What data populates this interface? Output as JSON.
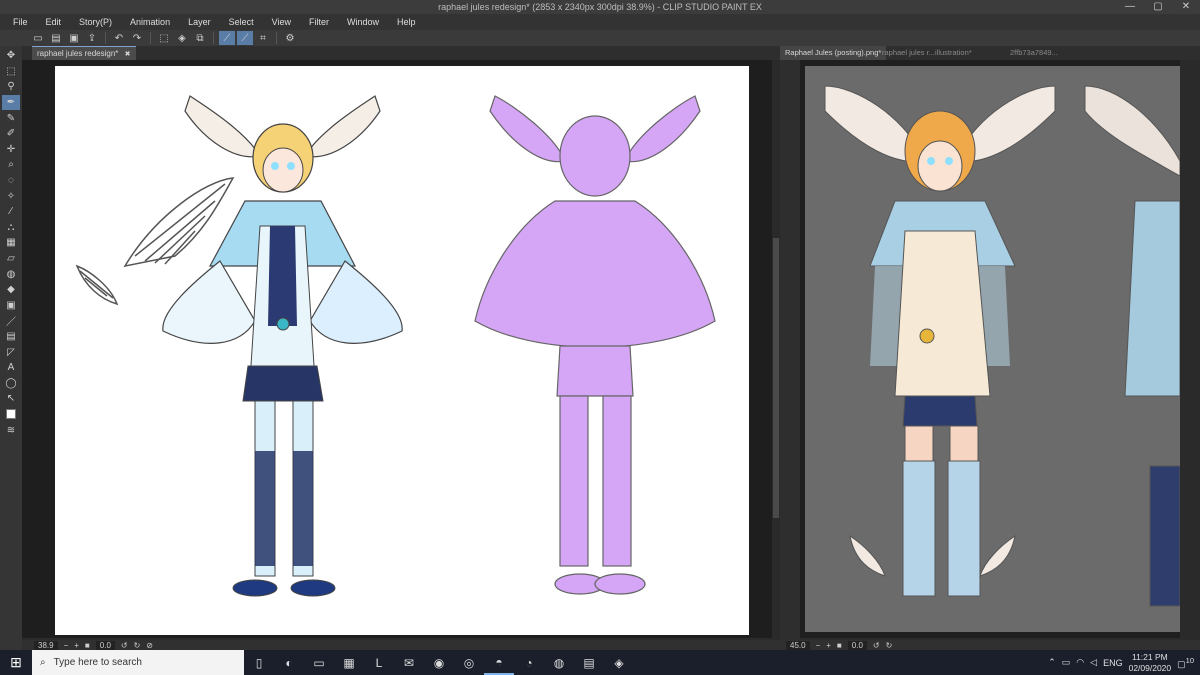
{
  "window": {
    "title": "raphael jules redesign* (2853 x 2340px 300dpi 38.9%)  - CLIP STUDIO PAINT EX",
    "minimize": "—",
    "maximize": "▢",
    "close": "✕"
  },
  "menu": [
    "File",
    "Edit",
    "Story(P)",
    "Animation",
    "Layer",
    "Select",
    "View",
    "Filter",
    "Window",
    "Help"
  ],
  "left_canvas": {
    "tab_label": "raphael jules redesign*",
    "tab_close": "✖",
    "zoom": "38.9",
    "rotation": "0.0"
  },
  "right_canvas": {
    "tabs": [
      "Raphael Jules (posting).png*",
      "raphael jules r...",
      "illustration*",
      "2ffb73a7849..."
    ],
    "zoom": "45.0",
    "rotation": "0.0"
  },
  "taskbar": {
    "search_placeholder": "Type here to search",
    "language": "ENG",
    "time": "11:21 PM",
    "date": "02/09/2020",
    "notifications": "10"
  },
  "colors": {
    "cape_blue": "#a7dbf2",
    "silhouette_purple": "#d4a6f5",
    "hair_yellow": "#f6d276",
    "accent_tab": "#7ea3cf"
  }
}
